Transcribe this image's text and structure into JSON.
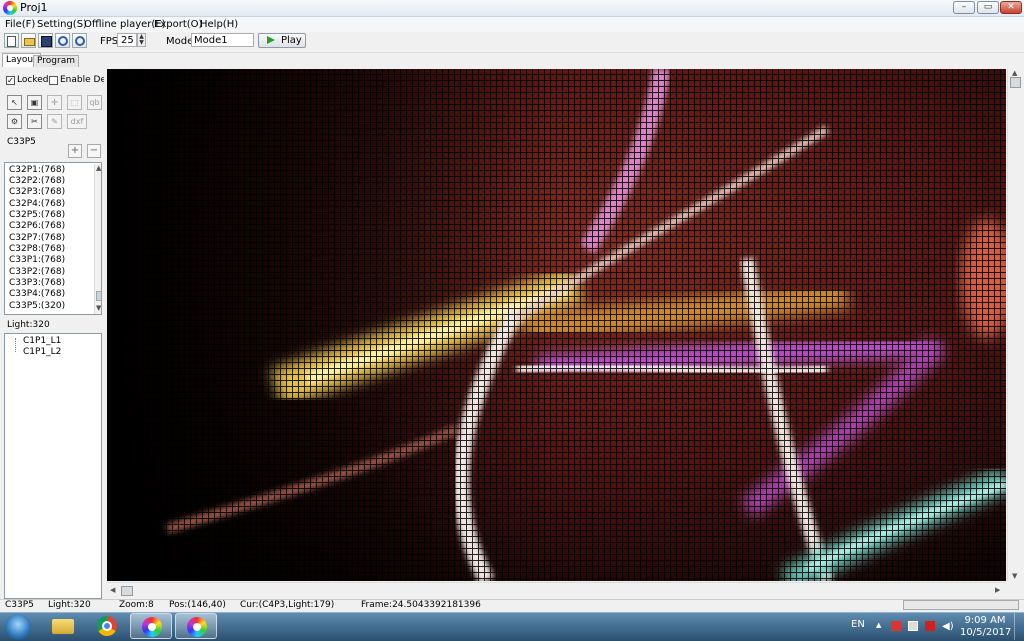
{
  "window": {
    "title": "Proj1",
    "controls": [
      "–",
      "▭",
      "✕"
    ]
  },
  "menu": [
    "File(F)",
    "Setting(S)",
    "Offline player(E)",
    "Export(O)",
    "Help(H)"
  ],
  "toolbar": {
    "fps_label": "FPS:",
    "fps_value": "25",
    "mode_label": "Mode:",
    "mode_value": "Mode1",
    "play_label": "Play",
    "icons": [
      "new-file-icon",
      "open-folder-icon",
      "save-icon",
      "zoom-in-icon",
      "zoom-out-icon"
    ]
  },
  "tabs": {
    "layout": "Layout",
    "program": "Program"
  },
  "left_panel": {
    "locked_label": "Locked",
    "locked_checked": true,
    "debug_label": "Enable Debug",
    "debug_checked": false,
    "tool_buttons": [
      "↖",
      "▣",
      "✛",
      "⬚",
      "qb",
      "⚙",
      "✂",
      "✎",
      "dxf"
    ],
    "group_title": "C33P5",
    "add": "+",
    "remove": "−",
    "ports": [
      "C32P1:(768)",
      "C32P2:(768)",
      "C32P3:(768)",
      "C32P4:(768)",
      "C32P5:(768)",
      "C32P6:(768)",
      "C32P7:(768)",
      "C32P8:(768)",
      "C33P1:(768)",
      "C33P2:(768)",
      "C33P3:(768)",
      "C33P4:(768)",
      "C33P5:(320)"
    ],
    "light_title": "Light:320",
    "tree_items": [
      "C1P1_L1",
      "C1P1_L2"
    ]
  },
  "status": {
    "port": "C33P5",
    "light": "Light:320",
    "zoom": "Zoom:8",
    "pos": "Pos:(146,40)",
    "cur": "Cur:(C4P3,Light:179)",
    "frame": "Frame:24.5043392181396"
  },
  "taskbar": {
    "apps": [
      "windows-explorer",
      "google-chrome",
      "led-editor",
      "led-editor"
    ],
    "language": "EN",
    "time": "9:09 AM",
    "date": "10/5/2017"
  }
}
